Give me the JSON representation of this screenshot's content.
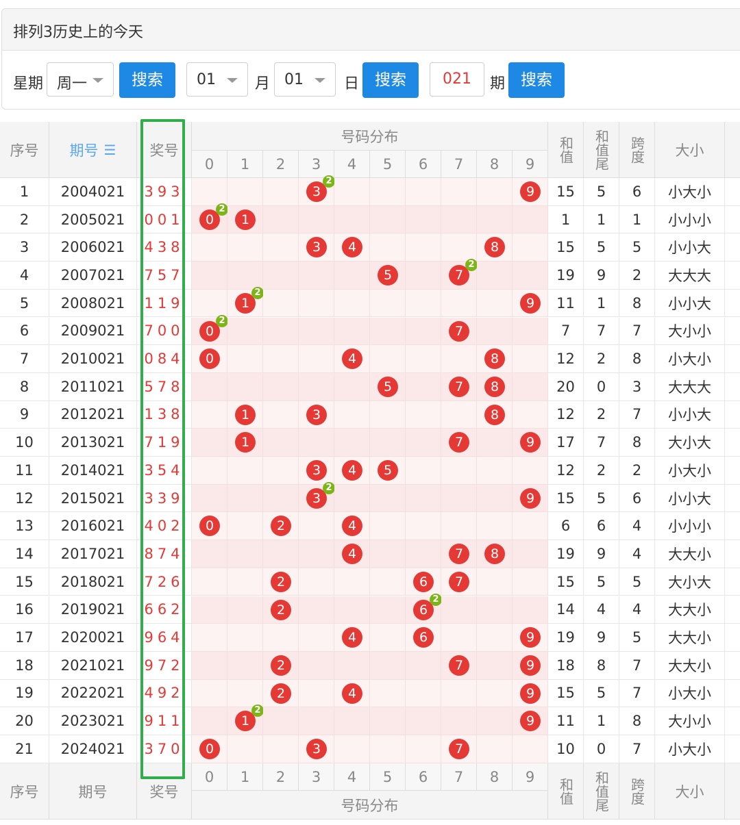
{
  "title": "排列3历史上的今天",
  "filters": {
    "weekday_label": "星期",
    "weekday_value": "周一",
    "search1": "搜索",
    "month_value": "01",
    "month_label": "月",
    "day_value": "01",
    "day_label": "日",
    "search2": "搜索",
    "period_value": "021",
    "period_label": "期",
    "search3": "搜索"
  },
  "headers": {
    "seq": "序号",
    "period": "期号",
    "prize": "奖号",
    "dist": "号码分布",
    "sum": "和值",
    "sum_tail": "和值尾",
    "span": "跨度",
    "size": "大小",
    "sort_icon": "sort-icon",
    "digits": [
      "0",
      "1",
      "2",
      "3",
      "4",
      "5",
      "6",
      "7",
      "8",
      "9"
    ]
  },
  "rows": [
    {
      "seq": "1",
      "period": "2004021",
      "prize": "393",
      "sum": "15",
      "tail": "5",
      "span": "6",
      "size": "小大小",
      "balls": [
        3,
        9
      ],
      "dup": 3
    },
    {
      "seq": "2",
      "period": "2005021",
      "prize": "001",
      "sum": "1",
      "tail": "1",
      "span": "1",
      "size": "小小小",
      "balls": [
        0,
        1
      ],
      "dup": 0
    },
    {
      "seq": "3",
      "period": "2006021",
      "prize": "438",
      "sum": "15",
      "tail": "5",
      "span": "5",
      "size": "小小大",
      "balls": [
        3,
        4,
        8
      ],
      "dup": null
    },
    {
      "seq": "4",
      "period": "2007021",
      "prize": "757",
      "sum": "19",
      "tail": "9",
      "span": "2",
      "size": "大大大",
      "balls": [
        5,
        7
      ],
      "dup": 7
    },
    {
      "seq": "5",
      "period": "2008021",
      "prize": "119",
      "sum": "11",
      "tail": "1",
      "span": "8",
      "size": "小小大",
      "balls": [
        1,
        9
      ],
      "dup": 1
    },
    {
      "seq": "6",
      "period": "2009021",
      "prize": "700",
      "sum": "7",
      "tail": "7",
      "span": "7",
      "size": "大小小",
      "balls": [
        0,
        7
      ],
      "dup": 0
    },
    {
      "seq": "7",
      "period": "2010021",
      "prize": "084",
      "sum": "12",
      "tail": "2",
      "span": "8",
      "size": "小大小",
      "balls": [
        0,
        4,
        8
      ],
      "dup": null
    },
    {
      "seq": "8",
      "period": "2011021",
      "prize": "578",
      "sum": "20",
      "tail": "0",
      "span": "3",
      "size": "大大大",
      "balls": [
        5,
        7,
        8
      ],
      "dup": null
    },
    {
      "seq": "9",
      "period": "2012021",
      "prize": "138",
      "sum": "12",
      "tail": "2",
      "span": "7",
      "size": "小小大",
      "balls": [
        1,
        3,
        8
      ],
      "dup": null
    },
    {
      "seq": "10",
      "period": "2013021",
      "prize": "719",
      "sum": "17",
      "tail": "7",
      "span": "8",
      "size": "大小大",
      "balls": [
        1,
        7,
        9
      ],
      "dup": null
    },
    {
      "seq": "11",
      "period": "2014021",
      "prize": "354",
      "sum": "12",
      "tail": "2",
      "span": "2",
      "size": "小大小",
      "balls": [
        3,
        4,
        5
      ],
      "dup": null
    },
    {
      "seq": "12",
      "period": "2015021",
      "prize": "339",
      "sum": "15",
      "tail": "5",
      "span": "6",
      "size": "小小大",
      "balls": [
        3,
        9
      ],
      "dup": 3
    },
    {
      "seq": "13",
      "period": "2016021",
      "prize": "402",
      "sum": "6",
      "tail": "6",
      "span": "4",
      "size": "小小小",
      "balls": [
        0,
        2,
        4
      ],
      "dup": null
    },
    {
      "seq": "14",
      "period": "2017021",
      "prize": "874",
      "sum": "19",
      "tail": "9",
      "span": "4",
      "size": "大大小",
      "balls": [
        4,
        7,
        8
      ],
      "dup": null
    },
    {
      "seq": "15",
      "period": "2018021",
      "prize": "726",
      "sum": "15",
      "tail": "5",
      "span": "5",
      "size": "大小大",
      "balls": [
        2,
        6,
        7
      ],
      "dup": null
    },
    {
      "seq": "16",
      "period": "2019021",
      "prize": "662",
      "sum": "14",
      "tail": "4",
      "span": "4",
      "size": "大大小",
      "balls": [
        2,
        6
      ],
      "dup": 6
    },
    {
      "seq": "17",
      "period": "2020021",
      "prize": "964",
      "sum": "19",
      "tail": "9",
      "span": "5",
      "size": "大大小",
      "balls": [
        4,
        6,
        9
      ],
      "dup": null
    },
    {
      "seq": "18",
      "period": "2021021",
      "prize": "972",
      "sum": "18",
      "tail": "8",
      "span": "7",
      "size": "大大小",
      "balls": [
        2,
        7,
        9
      ],
      "dup": null
    },
    {
      "seq": "19",
      "period": "2022021",
      "prize": "492",
      "sum": "15",
      "tail": "5",
      "span": "7",
      "size": "小大小",
      "balls": [
        2,
        4,
        9
      ],
      "dup": null
    },
    {
      "seq": "20",
      "period": "2023021",
      "prize": "911",
      "sum": "11",
      "tail": "1",
      "span": "8",
      "size": "大小小",
      "balls": [
        1,
        9
      ],
      "dup": 1
    },
    {
      "seq": "21",
      "period": "2024021",
      "prize": "370",
      "sum": "10",
      "tail": "0",
      "span": "7",
      "size": "小大小",
      "balls": [
        0,
        3,
        7
      ],
      "dup": null
    }
  ],
  "dup_mark": "2",
  "colors": {
    "accent": "#1e88e5",
    "ball": "#e53935",
    "dup": "#7cb518",
    "highlight_box": "#2fae49"
  }
}
